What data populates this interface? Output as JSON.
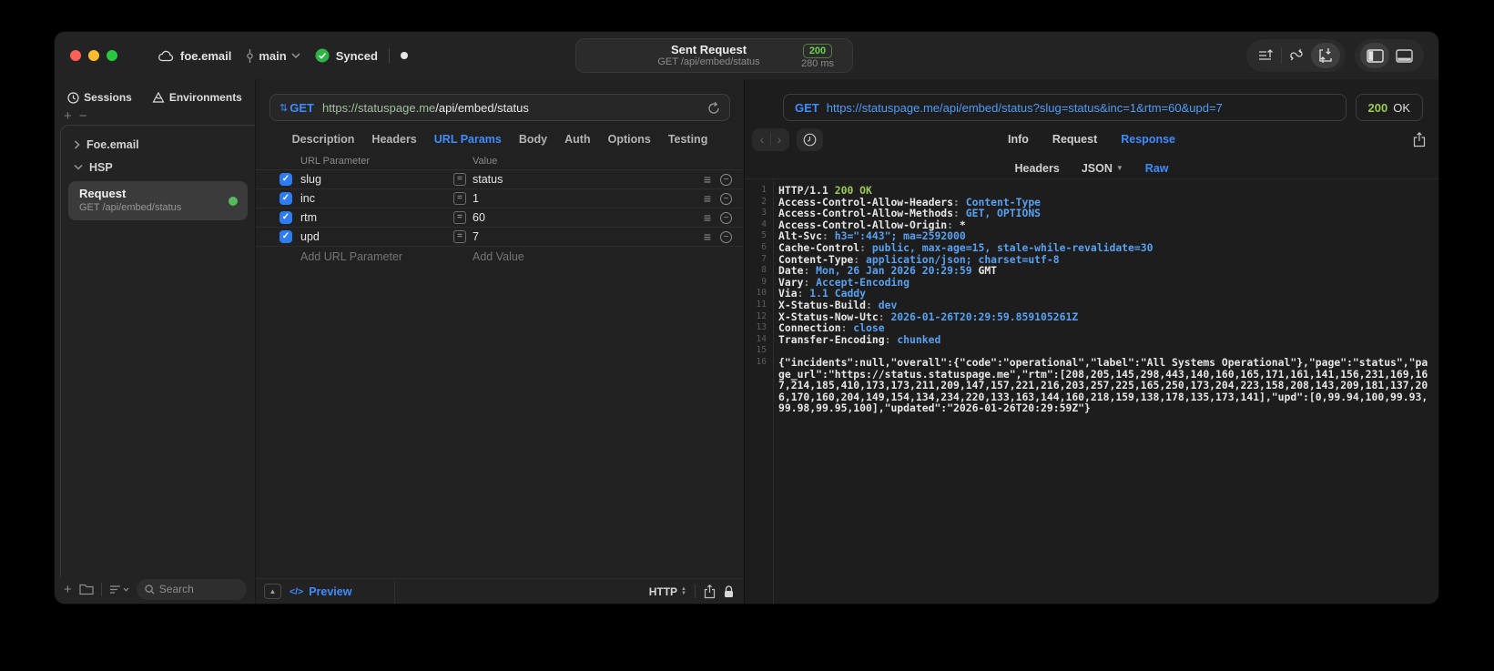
{
  "titlebar": {
    "project": "foe.email",
    "branch": "main",
    "sync_status": "Synced",
    "request_summary": {
      "title": "Sent Request",
      "subtitle": "GET /api/embed/status",
      "status_code": "200",
      "duration": "280 ms"
    }
  },
  "sidebar": {
    "tabs": [
      {
        "label": "Sessions"
      },
      {
        "label": "Environments"
      }
    ],
    "tree": [
      {
        "label": "Foe.email",
        "state": "collapsed"
      },
      {
        "label": "HSP",
        "state": "expanded"
      }
    ],
    "request_item": {
      "title": "Request",
      "subtitle": "GET /api/embed/status",
      "status_dot_color": "#58b85c"
    },
    "search_placeholder": "Search"
  },
  "request_editor": {
    "method": "GET",
    "url_host": "https://statuspage.me",
    "url_path": "/api/embed/status",
    "tabs": [
      "Description",
      "Headers",
      "URL Params",
      "Body",
      "Auth",
      "Options",
      "Testing"
    ],
    "active_tab": "URL Params",
    "params": {
      "columns": [
        "URL Parameter",
        "Value"
      ],
      "rows": [
        {
          "name": "slug",
          "value": "status",
          "checked": true
        },
        {
          "name": "inc",
          "value": "1",
          "checked": true
        },
        {
          "name": "rtm",
          "value": "60",
          "checked": true
        },
        {
          "name": "upd",
          "value": "7",
          "checked": true
        }
      ],
      "add_name_placeholder": "Add URL Parameter",
      "add_value_placeholder": "Add Value"
    },
    "footer": {
      "code_glyph": "</>",
      "preview_label": "Preview",
      "protocol": "HTTP"
    }
  },
  "response_viewer": {
    "method": "GET",
    "url": "https://statuspage.me/api/embed/status?slug=status&inc=1&rtm=60&upd=7",
    "status_code": "200",
    "status_text": "OK",
    "tabs": [
      "Info",
      "Request",
      "Response"
    ],
    "active_tab": "Response",
    "subtabs": [
      "Headers",
      "JSON",
      "Raw"
    ],
    "active_subtab": "Raw",
    "body_lines": [
      {
        "num": 1,
        "parts": [
          [
            "HTTP/1.1 ",
            "w"
          ],
          [
            "200 OK",
            "g"
          ]
        ]
      },
      {
        "num": 2,
        "parts": [
          [
            "Access-Control-Allow-Headers",
            "w"
          ],
          [
            ": ",
            "d"
          ],
          [
            "Content-Type",
            "b"
          ]
        ]
      },
      {
        "num": 3,
        "parts": [
          [
            "Access-Control-Allow-Methods",
            "w"
          ],
          [
            ": ",
            "d"
          ],
          [
            "GET, OPTIONS",
            "b"
          ]
        ]
      },
      {
        "num": 4,
        "parts": [
          [
            "Access-Control-Allow-Origin",
            "w"
          ],
          [
            ": ",
            "d"
          ],
          [
            "*",
            "w"
          ]
        ]
      },
      {
        "num": 5,
        "parts": [
          [
            "Alt-Svc",
            "w"
          ],
          [
            ": ",
            "d"
          ],
          [
            "h3=\":443\"; ma=2592000",
            "b"
          ]
        ]
      },
      {
        "num": 6,
        "parts": [
          [
            "Cache-Control",
            "w"
          ],
          [
            ": ",
            "d"
          ],
          [
            "public, max-age=15, stale-while-revalidate=30",
            "b"
          ]
        ]
      },
      {
        "num": 7,
        "parts": [
          [
            "Content-Type",
            "w"
          ],
          [
            ": ",
            "d"
          ],
          [
            "application/json; charset=utf-8",
            "b"
          ]
        ]
      },
      {
        "num": 8,
        "parts": [
          [
            "Date",
            "w"
          ],
          [
            ": ",
            "d"
          ],
          [
            "Mon, 26 Jan 2026 20:29:59",
            "b"
          ],
          [
            " GMT",
            "w"
          ]
        ]
      },
      {
        "num": 9,
        "parts": [
          [
            "Vary",
            "w"
          ],
          [
            ": ",
            "d"
          ],
          [
            "Accept-Encoding",
            "b"
          ]
        ]
      },
      {
        "num": 10,
        "parts": [
          [
            "Via",
            "w"
          ],
          [
            ": ",
            "d"
          ],
          [
            "1.1 Caddy",
            "b"
          ]
        ]
      },
      {
        "num": 11,
        "parts": [
          [
            "X-Status-Build",
            "w"
          ],
          [
            ": ",
            "d"
          ],
          [
            "dev",
            "b"
          ]
        ]
      },
      {
        "num": 12,
        "parts": [
          [
            "X-Status-Now-Utc",
            "w"
          ],
          [
            ": ",
            "d"
          ],
          [
            "2026-01-26T20:29:59.859105261Z",
            "b"
          ]
        ]
      },
      {
        "num": 13,
        "parts": [
          [
            "Connection",
            "w"
          ],
          [
            ": ",
            "d"
          ],
          [
            "close",
            "b"
          ]
        ]
      },
      {
        "num": 14,
        "parts": [
          [
            "Transfer-Encoding",
            "w"
          ],
          [
            ": ",
            "d"
          ],
          [
            "chunked",
            "b"
          ]
        ]
      },
      {
        "num": 15,
        "parts": []
      },
      {
        "num": 16,
        "parts": [
          [
            "{\"incidents\":null,\"overall\":{\"code\":\"operational\",\"label\":\"All Systems Operational\"},\"page\":\"status\",\"page_url\":\"https://status.statuspage.me\",\"rtm\":[208,205,145,298,443,140,160,165,171,161,141,156,231,169,167,214,185,410,173,173,211,209,147,157,221,216,203,257,225,165,250,173,204,223,158,208,143,209,181,137,206,170,160,204,149,154,134,234,220,133,163,144,160,218,159,138,178,135,173,141],\"upd\":[0,99.94,100,99.93,99.98,99.95,100],\"updated\":\"2026-01-26T20:29:59Z\"}",
            "w"
          ]
        ]
      }
    ]
  },
  "colors": {
    "accent_blue": "#3f8cff",
    "link_blue": "#59a1f1",
    "response_green": "#9ac954",
    "badge_green": "#6fcf4f",
    "traffic_red": "#ff5f57",
    "traffic_yellow": "#febc2e",
    "traffic_green": "#28c840",
    "checkbox_blue": "#2e7bf6",
    "request_dot_green": "#58b85c"
  }
}
